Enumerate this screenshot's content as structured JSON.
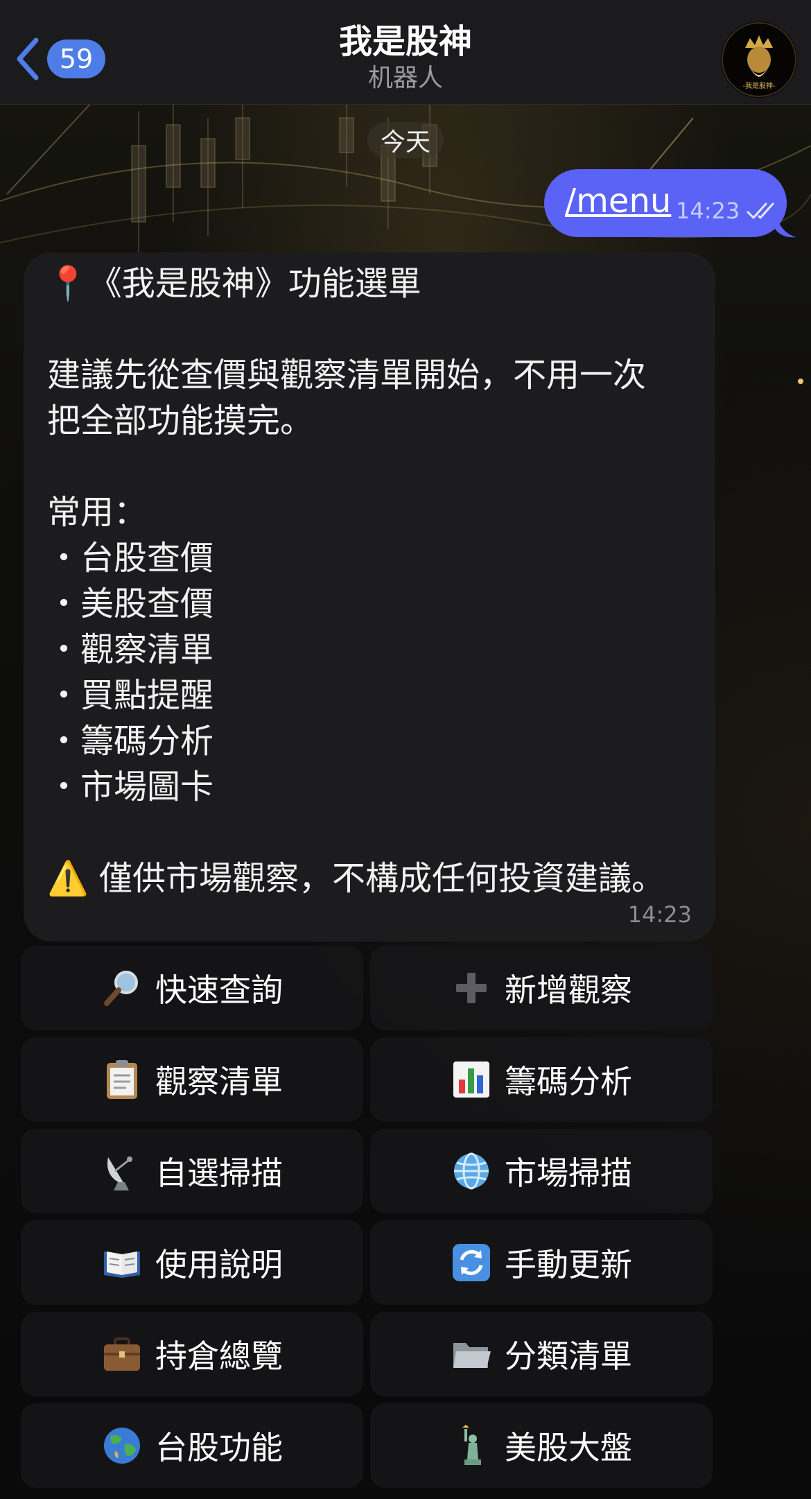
{
  "header": {
    "back_count": "59",
    "title": "我是股神",
    "subtitle": "机器人",
    "avatar_text": "-我是股神-"
  },
  "date_separator": "今天",
  "outgoing": {
    "text": "/menu",
    "time": "14:23"
  },
  "incoming": {
    "text": "📍《我是股神》功能選單\n\n建議先從查價與觀察清單開始，不用一次\n把全部功能摸完。\n\n常用：\n・台股查價\n・美股查價\n・觀察清單\n・買點提醒\n・籌碼分析\n・市場圖卡\n\n⚠️ 僅供市場觀察，不構成任何投資建議。",
    "time": "14:23"
  },
  "keyboard": [
    {
      "icon": "magnifier-icon",
      "label": "快速查詢"
    },
    {
      "icon": "plus-icon",
      "label": "新增觀察"
    },
    {
      "icon": "clipboard-icon",
      "label": "觀察清單"
    },
    {
      "icon": "bar-chart-icon",
      "label": "籌碼分析"
    },
    {
      "icon": "satellite-dish-icon",
      "label": "自選掃描"
    },
    {
      "icon": "globe-meridians-icon",
      "label": "市場掃描"
    },
    {
      "icon": "open-book-icon",
      "label": "使用說明"
    },
    {
      "icon": "refresh-icon",
      "label": "手動更新"
    },
    {
      "icon": "briefcase-icon",
      "label": "持倉總覽"
    },
    {
      "icon": "folder-icon",
      "label": "分類清單"
    },
    {
      "icon": "earth-icon",
      "label": "台股功能"
    },
    {
      "icon": "statue-of-liberty-icon",
      "label": "美股大盤"
    }
  ],
  "colors": {
    "accent": "#4f7de8",
    "outgoing_bubble": "#5a63f5",
    "incoming_bubble": "#1c1c1e"
  }
}
